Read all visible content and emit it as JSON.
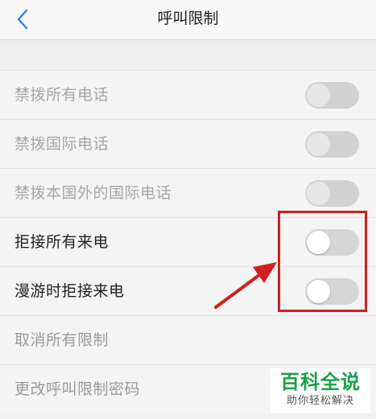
{
  "header": {
    "title": "呼叫限制"
  },
  "settings": [
    {
      "label": "禁拨所有电话",
      "state": "off",
      "enabled": false
    },
    {
      "label": "禁拨国际电话",
      "state": "off",
      "enabled": false
    },
    {
      "label": "禁拨本国外的国际电话",
      "state": "off",
      "enabled": false
    },
    {
      "label": "拒接所有来电",
      "state": "off",
      "enabled": true
    },
    {
      "label": "漫游时拒接来电",
      "state": "off",
      "enabled": true
    }
  ],
  "actions": [
    {
      "label": "取消所有限制"
    },
    {
      "label": "更改呼叫限制密码"
    }
  ],
  "watermark": {
    "main": "百科全说",
    "sub": "助你轻松解决"
  },
  "colors": {
    "accent": "#2a82e4",
    "annotation": "#d0201f",
    "watermark": "#1aa049"
  }
}
